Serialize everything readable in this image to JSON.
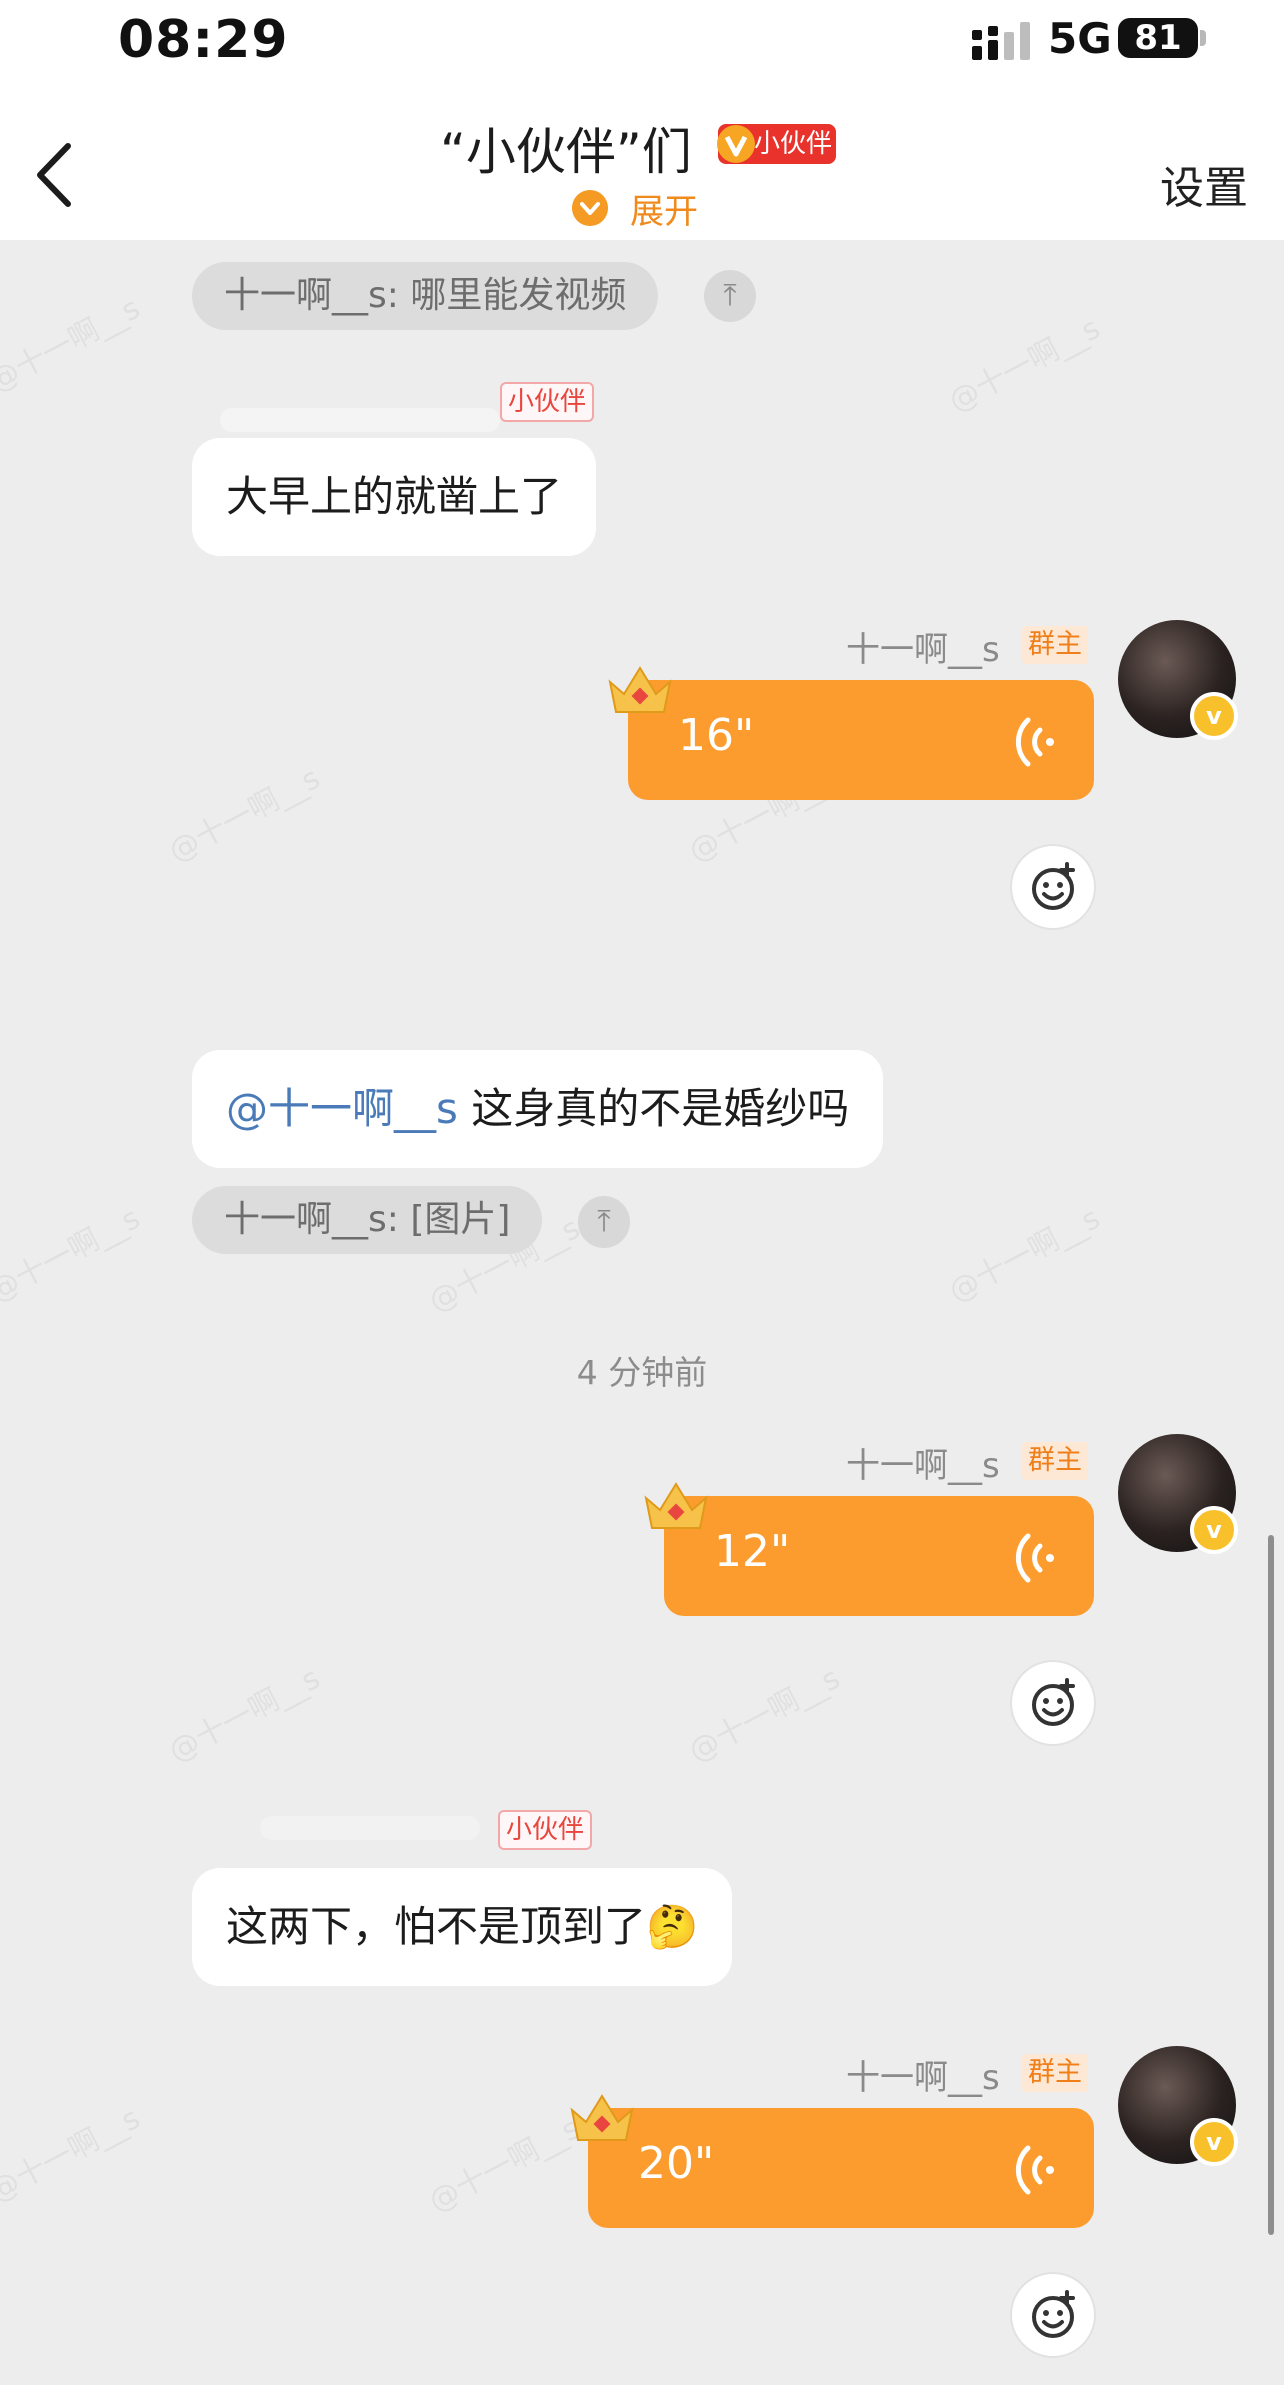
{
  "status_bar": {
    "time": "08:29",
    "network": "5G",
    "battery": "81"
  },
  "header": {
    "title": "“小伙伴”们",
    "title_badge": "小伙伴",
    "expand_label": "展开",
    "settings_label": "设置"
  },
  "watermark": "@十一啊__s",
  "messages": [
    {
      "quote": "十一啊__s: 哪里能发视频"
    },
    {
      "sender_badge": "小伙伴",
      "text": "大早上的就凿上了"
    },
    {
      "sender": "十一啊__s",
      "role_badge": "群主",
      "voice_duration": "16\""
    },
    {
      "text_mention": "@十一啊__s",
      "text": " 这身真的不是婚纱吗",
      "quote": "十一啊__s: [图片]"
    },
    {
      "time_divider": "4 分钟前"
    },
    {
      "sender": "十一啊__s",
      "role_badge": "群主",
      "voice_duration": "12\""
    },
    {
      "sender_badge": "小伙伴",
      "text": "这两下，怕不是顶到了",
      "emoji": "🤔"
    },
    {
      "sender": "十一啊__s",
      "role_badge": "群主",
      "voice_duration": "20\""
    }
  ],
  "colors": {
    "accent": "#fc9c2f",
    "background": "#ededed",
    "mention": "#4a7bb8"
  }
}
